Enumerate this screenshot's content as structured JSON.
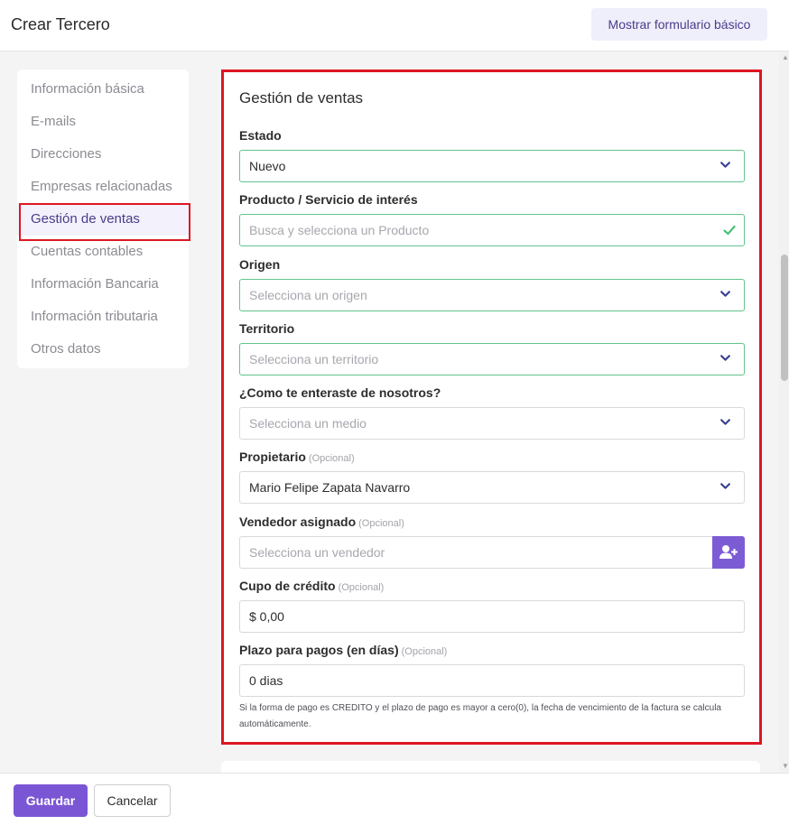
{
  "header": {
    "title": "Crear Tercero",
    "basic_form_button": "Mostrar formulario básico"
  },
  "sidebar": {
    "items": [
      {
        "label": "Información básica"
      },
      {
        "label": "E-mails"
      },
      {
        "label": "Direcciones"
      },
      {
        "label": "Empresas relacionadas"
      },
      {
        "label": "Gestión de ventas",
        "active": true
      },
      {
        "label": "Cuentas contables"
      },
      {
        "label": "Información Bancaria"
      },
      {
        "label": "Información tributaria"
      },
      {
        "label": "Otros datos"
      }
    ]
  },
  "section": {
    "title": "Gestión de ventas",
    "fields": {
      "estado": {
        "label": "Estado",
        "value": "Nuevo"
      },
      "producto": {
        "label": "Producto / Servicio de interés",
        "placeholder": "Busca y selecciona un Producto"
      },
      "origen": {
        "label": "Origen",
        "placeholder": "Selecciona un origen"
      },
      "territorio": {
        "label": "Territorio",
        "placeholder": "Selecciona un territorio"
      },
      "medio": {
        "label": "¿Como te enteraste de nosotros?",
        "placeholder": "Selecciona un medio"
      },
      "propietario": {
        "label": "Propietario",
        "optional": "(Opcional)",
        "value": "Mario Felipe Zapata Navarro"
      },
      "vendedor": {
        "label": "Vendedor asignado",
        "optional": "(Opcional)",
        "placeholder": "Selecciona un vendedor"
      },
      "cupo": {
        "label": "Cupo de crédito",
        "optional": "(Opcional)",
        "value": "$ 0,00"
      },
      "plazo": {
        "label": "Plazo para pagos (en días)",
        "optional": "(Opcional)",
        "value": "0 dias",
        "hint": "Si la forma de pago es CREDITO y el plazo de pago es mayor a cero(0), la fecha de vencimiento de la factura se calcula automáticamente."
      }
    }
  },
  "footer": {
    "save_label": "Guardar",
    "cancel_label": "Cancelar"
  },
  "colors": {
    "accent": "#7b56d4",
    "highlight_border": "#dd1722",
    "valid_border": "#63c48d"
  }
}
